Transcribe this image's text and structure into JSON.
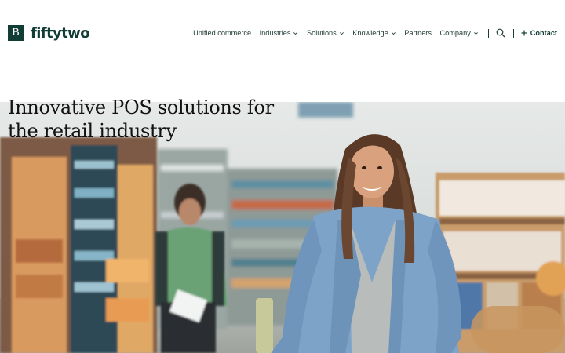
{
  "brand": {
    "logo_mark": "B",
    "name": "fiftytwo"
  },
  "nav": {
    "items": [
      {
        "label": "Unified commerce",
        "dropdown": false
      },
      {
        "label": "Industries",
        "dropdown": true
      },
      {
        "label": "Solutions",
        "dropdown": true
      },
      {
        "label": "Knowledge",
        "dropdown": true
      },
      {
        "label": "Partners",
        "dropdown": false
      },
      {
        "label": "Company",
        "dropdown": true
      }
    ],
    "search_icon": "search-icon",
    "contact_label": "Contact",
    "contact_icon": "plus-icon"
  },
  "hero": {
    "title_line1": "Innovative POS solutions for",
    "title_line2": "the retail industry",
    "image": "photo-woman-shopping-in-supermarket-aisle"
  },
  "colors": {
    "brand_dark": "#123d36",
    "text": "#1d3a35",
    "background": "#ffffff"
  }
}
